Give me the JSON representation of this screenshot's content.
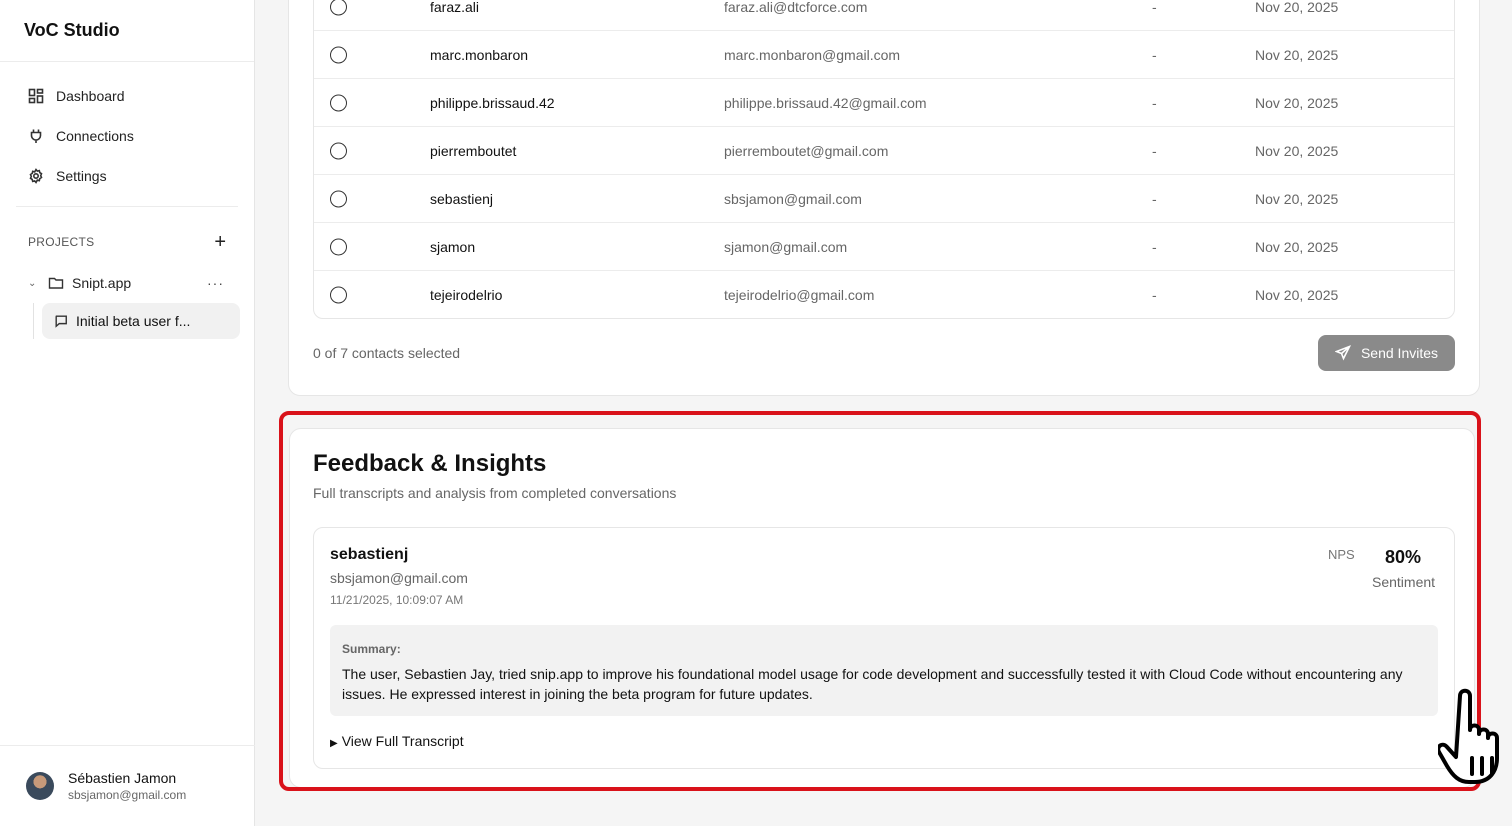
{
  "sidebar": {
    "brand": "VoC Studio",
    "nav": [
      {
        "label": "Dashboard",
        "icon": "dashboard-icon"
      },
      {
        "label": "Connections",
        "icon": "plug-icon"
      },
      {
        "label": "Settings",
        "icon": "gear-icon"
      }
    ],
    "projects_label": "PROJECTS",
    "project": {
      "name": "Snipt.app",
      "menu": "···"
    },
    "sub_item": "Initial beta user f...",
    "user": {
      "name": "Sébastien Jamon",
      "email": "sbsjamon@gmail.com"
    }
  },
  "contacts": {
    "rows": [
      {
        "user": "faraz.ali",
        "email": "faraz.ali@dtcforce.com",
        "dash": "-",
        "date": "Nov 20, 2025"
      },
      {
        "user": "marc.monbaron",
        "email": "marc.monbaron@gmail.com",
        "dash": "-",
        "date": "Nov 20, 2025"
      },
      {
        "user": "philippe.brissaud.42",
        "email": "philippe.brissaud.42@gmail.com",
        "dash": "-",
        "date": "Nov 20, 2025"
      },
      {
        "user": "pierremboutet",
        "email": "pierremboutet@gmail.com",
        "dash": "-",
        "date": "Nov 20, 2025"
      },
      {
        "user": "sebastienj",
        "email": "sbsjamon@gmail.com",
        "dash": "-",
        "date": "Nov 20, 2025"
      },
      {
        "user": "sjamon",
        "email": "sjamon@gmail.com",
        "dash": "-",
        "date": "Nov 20, 2025"
      },
      {
        "user": "tejeirodelrio",
        "email": "tejeirodelrio@gmail.com",
        "dash": "-",
        "date": "Nov 20, 2025"
      }
    ],
    "selected_text": "0 of 7 contacts selected",
    "send_label": "Send Invites"
  },
  "feedback": {
    "title": "Feedback & Insights",
    "subtitle": "Full transcripts and analysis from completed conversations",
    "entry": {
      "name": "sebastienj",
      "email": "sbsjamon@gmail.com",
      "timestamp": "11/21/2025, 10:09:07 AM",
      "nps_label": "NPS",
      "sentiment_value": "80%",
      "sentiment_label": "Sentiment",
      "summary_label": "Summary:",
      "summary_text": "The user, Sebastien Jay, tried snip.app to improve his foundational model usage for code development and successfully tested it with Cloud Code without encountering any issues. He expressed interest in joining the beta program for future updates.",
      "transcript_label": "View Full Transcript"
    }
  },
  "colors": {
    "highlight": "#d9121a",
    "button_bg": "#8a8a8a"
  }
}
